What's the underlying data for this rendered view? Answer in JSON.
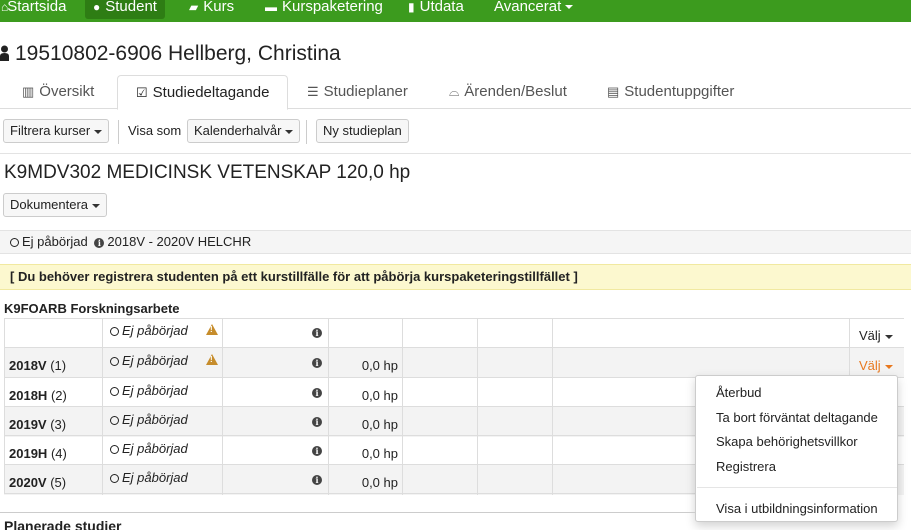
{
  "nav": {
    "items": [
      {
        "label": "Startsida",
        "icon": "home-icon"
      },
      {
        "label": "Student",
        "icon": "user-icon",
        "active": true
      },
      {
        "label": "Kurs",
        "icon": "book-icon"
      },
      {
        "label": "Kurspaketering",
        "icon": "folder-icon"
      },
      {
        "label": "Utdata",
        "icon": "file-icon"
      },
      {
        "label": "Avancerat",
        "icon": "caret-icon"
      }
    ],
    "color": "#3c9b1e"
  },
  "student": {
    "title": "19510802-6906 Hellberg, Christina"
  },
  "tabs": [
    {
      "label": "Översikt",
      "icon": "map-icon"
    },
    {
      "label": "Studiedeltagande",
      "icon": "check-square-icon",
      "active": true
    },
    {
      "label": "Studieplaner",
      "icon": "list-icon"
    },
    {
      "label": "Ärenden/Beslut",
      "icon": "inbox-icon"
    },
    {
      "label": "Studentuppgifter",
      "icon": "file-icon"
    }
  ],
  "toolbar": {
    "filter_label": "Filtrera kurser",
    "view_as_label": "Visa som",
    "view_select_value": "Kalenderhalvår",
    "new_plan_label": "Ny studieplan"
  },
  "course": {
    "title": "K9MDV302 MEDICINSK VETENSKAP 120,0 hp",
    "document_label": "Dokumentera",
    "status_text": "Ej påbörjad",
    "period_text": "2018V - 2020V HELCHR"
  },
  "warning": {
    "text": "[ Du behöver registrera studenten på ett kurstillfälle för att påbörja kurspaketeringstillfället ]",
    "bg_color": "#fcf8cf"
  },
  "module": {
    "title": "K9FOARB Forskningsarbete",
    "header_status": "Ej påbörjad",
    "header_select": "Välj",
    "rows": [
      {
        "term": "2018V",
        "num": "(1)",
        "status": "Ej påbörjad",
        "hp": "0,0 hp",
        "select": "Välj",
        "warning": true
      },
      {
        "term": "2018H",
        "num": "(2)",
        "status": "Ej påbörjad",
        "hp": "0,0 hp"
      },
      {
        "term": "2019V",
        "num": "(3)",
        "status": "Ej påbörjad",
        "hp": "0,0 hp"
      },
      {
        "term": "2019H",
        "num": "(4)",
        "status": "Ej påbörjad",
        "hp": "0,0 hp"
      },
      {
        "term": "2020V",
        "num": "(5)",
        "status": "Ej påbörjad",
        "hp": "0,0 hp"
      }
    ]
  },
  "dropdown": {
    "items": [
      "Återbud",
      "Ta bort förväntat deltagande",
      "Skapa behörighetsvillkor",
      "Registrera"
    ],
    "footer_item": "Visa i utbildningsinformation"
  },
  "planned": {
    "title": "Planerade studier"
  }
}
